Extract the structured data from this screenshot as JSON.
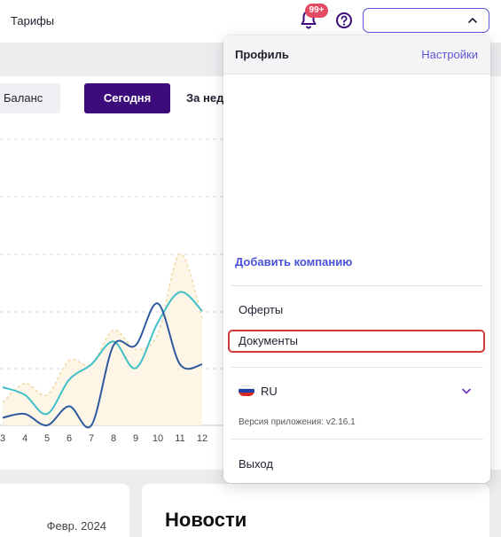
{
  "topbar": {
    "tariffs": "Тарифы",
    "notifications_badge": "99+"
  },
  "tabs": {
    "balance": "Баланс",
    "today": "Сегодня",
    "week": "За неделю"
  },
  "chart_data": {
    "type": "line",
    "x": [
      3,
      4,
      5,
      6,
      7,
      8,
      9,
      10,
      11,
      12
    ],
    "x_tick_labels": [
      "3",
      "4",
      "5",
      "6",
      "7",
      "8",
      "9",
      "10",
      "11",
      "12"
    ],
    "series": [
      {
        "color": "#41bfc9",
        "values": [
          1.0,
          0.8,
          0.3,
          1.2,
          1.6,
          2.2,
          1.5,
          2.7,
          3.5,
          3.0
        ]
      },
      {
        "color": "#2e5a9e",
        "values": [
          0.2,
          0.3,
          0.0,
          0.5,
          0.0,
          2.1,
          2.1,
          3.2,
          1.6,
          1.6
        ]
      },
      {
        "color": "#f3d9a8",
        "values": [
          0.6,
          1.1,
          0.8,
          1.7,
          1.6,
          2.5,
          2.0,
          2.4,
          4.5,
          2.8
        ]
      }
    ],
    "grid": true,
    "gridline_style": "dashed"
  },
  "profile_menu": {
    "title": "Профиль",
    "settings": "Настройки",
    "add_company": "Добавить компанию",
    "offers": "Оферты",
    "documents": "Документы",
    "language": "RU",
    "version": "Версия приложения: v2.16.1",
    "logout": "Выход"
  },
  "cards": {
    "date": "Февр. 2024",
    "news": "Новости"
  },
  "colors": {
    "accent": "#3c0d7a",
    "link": "#5b56d6",
    "highlight_border": "#d03a3a",
    "badge": "#e24b61"
  },
  "icons": {
    "bell": "bell-icon",
    "help": "help-circle-icon",
    "chevron": "chevron-up-icon",
    "lang_chevron": "chevron-down-icon",
    "flag": "russia-flag-icon"
  }
}
